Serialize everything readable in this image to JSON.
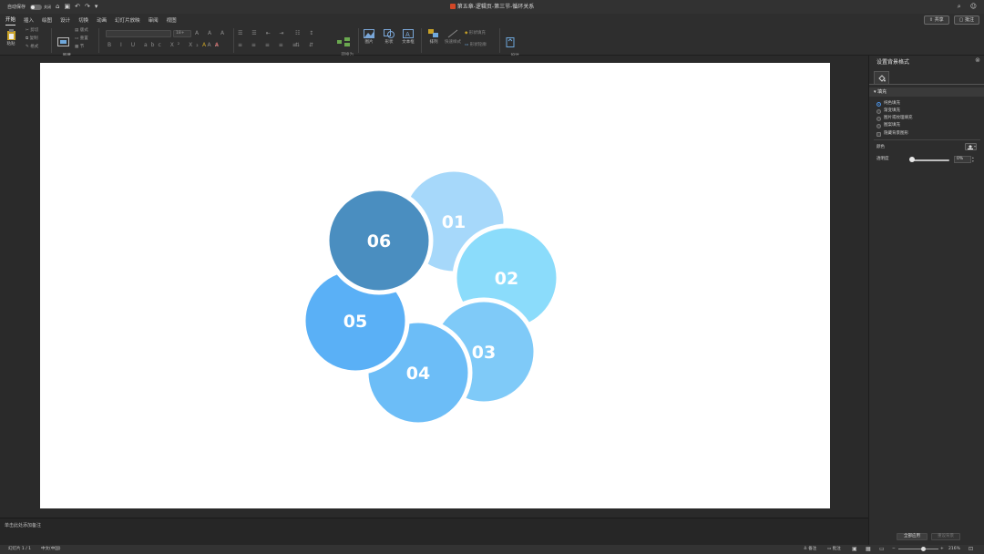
{
  "titlebar": {
    "autosave_label": "自动保存",
    "autosave_state": "关闭",
    "document_title": "第五章-逻辑页-第三节-循环关系"
  },
  "tabs": [
    "开始",
    "插入",
    "绘图",
    "设计",
    "切换",
    "动画",
    "幻灯片放映",
    "审阅",
    "视图"
  ],
  "share": {
    "share_label": "共享",
    "comment_label": "批注"
  },
  "ribbon": {
    "paste": "粘贴",
    "cut": "剪切",
    "copy": "复制",
    "format": "格式",
    "new_slide": "新建\n幻灯片",
    "layout": "版式",
    "reset": "重置",
    "section": "节",
    "font_size": "18+",
    "convert_smartart": "转换为\nSmartArt",
    "picture": "图片",
    "shape": "形状",
    "textbox": "文本框",
    "arrange": "排列",
    "quick_styles": "快速样式",
    "shape_fill": "形状填充",
    "shape_outline": "形状轮廓",
    "design_ideas": "设计\n灵感"
  },
  "slide": {
    "items": [
      {
        "label": "01",
        "color": "#A6D8FA"
      },
      {
        "label": "02",
        "color": "#8BDCFB"
      },
      {
        "label": "03",
        "color": "#7FCAF8"
      },
      {
        "label": "04",
        "color": "#6CBDF7"
      },
      {
        "label": "05",
        "color": "#5AB0F6"
      },
      {
        "label": "06",
        "color": "#4A8EC0"
      }
    ]
  },
  "notes": {
    "placeholder": "单击此处添加备注"
  },
  "pane": {
    "title": "设置背景格式",
    "section": "填充",
    "options": [
      "纯色填充",
      "渐变填充",
      "图片或纹理填充",
      "图案填充"
    ],
    "selected_option": "纯色填充",
    "hide_graphics": "隐藏背景图形",
    "color_label": "颜色",
    "transparency_label": "透明度",
    "transparency_value": "0%",
    "apply_all": "全部应用",
    "reset_background": "重设背景"
  },
  "status": {
    "slide_info": "幻灯片 1 / 1",
    "language": "中文(中国)",
    "notes_label": "备注",
    "comments_label": "批注",
    "zoom": "216%"
  }
}
